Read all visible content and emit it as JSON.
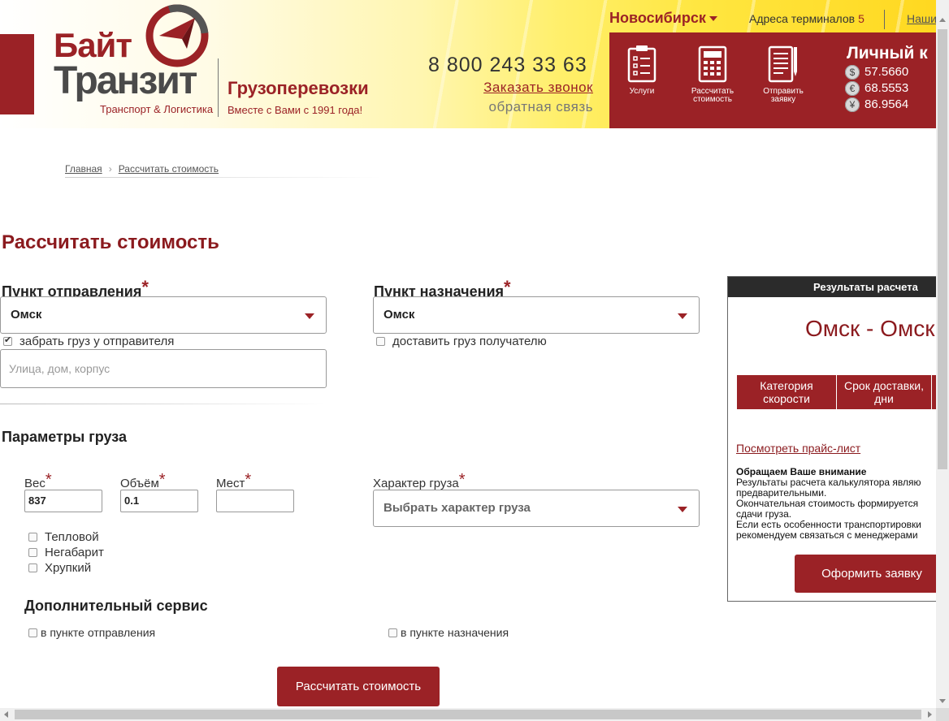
{
  "header": {
    "logo_word1": "Байт",
    "logo_word2": "Транзит",
    "logo_tagline": "Транспорт & Логистика",
    "freight": "Грузоперевозки",
    "since": "Вместе с Вами с 1991 года!",
    "phone": "8 800 243 33 63",
    "callback": "Заказать звонок",
    "feedback": "обратная связь",
    "city": "Новосибирск",
    "terminals_label": "Адреса терминалов",
    "terminals_count": "5",
    "ours_link": "Наши",
    "cabinet": "Личный к",
    "services": [
      {
        "label1": "Услуги",
        "label2": ""
      },
      {
        "label1": "Рассчитать",
        "label2": "стоимость"
      },
      {
        "label1": "Отправить",
        "label2": "заявку"
      }
    ],
    "rates": [
      {
        "symbol": "$",
        "value": "57.5660"
      },
      {
        "symbol": "€",
        "value": "68.5553"
      },
      {
        "symbol": "¥",
        "value": "86.9564"
      }
    ]
  },
  "breadcrumb": {
    "home": "Главная",
    "sep": "›",
    "current": "Рассчитать стоимость"
  },
  "form": {
    "title": "Рассчитать стоимость",
    "origin_label": "Пункт отправления",
    "origin_value": "Омск",
    "pickup_label": "забрать груз у отправителя",
    "pickup_checked": true,
    "address_placeholder": "Улица, дом, корпус",
    "dest_label": "Пункт назначения",
    "dest_value": "Омск",
    "delivery_label": "доставить груз получателю",
    "delivery_checked": false,
    "cargo_params_title": "Параметры груза",
    "weight_label": "Вес",
    "weight_value": "837",
    "volume_label": "Объём",
    "volume_value": "0.1",
    "places_label": "Мест",
    "places_value": "",
    "nature_label": "Характер груза",
    "nature_placeholder": "Выбрать характер груза",
    "options": [
      "Тепловой",
      "Негабарит",
      "Хрупкий"
    ],
    "extra_title": "Дополнительный сервис",
    "extra_origin": "в пункте отправления",
    "extra_dest": "в пункте назначения",
    "submit": "Рассчитать стоимость"
  },
  "results": {
    "title": "Результаты расчета",
    "route": "Омск - Омск",
    "col1_line1": "Категория",
    "col1_line2": "скорости",
    "col2_line1": "Срок доставки,",
    "col2_line2": "дни",
    "price_list": "Посмотреть прайс-лист",
    "notice_title": "Обращаем Ваше внимание",
    "notice_lines": [
      "Результаты расчета калькулятора являю",
      "предварительными.",
      "Окончательная стоимость формируется",
      "сдачи груза.",
      "Если есть особенности транспортировки",
      "рекомендуем связаться с менеджерами"
    ],
    "order_button": "Оформить заявку"
  },
  "colors": {
    "brand": "#9b2226",
    "title": "#8b1a1e",
    "header_bar": "#2b2b2b"
  }
}
